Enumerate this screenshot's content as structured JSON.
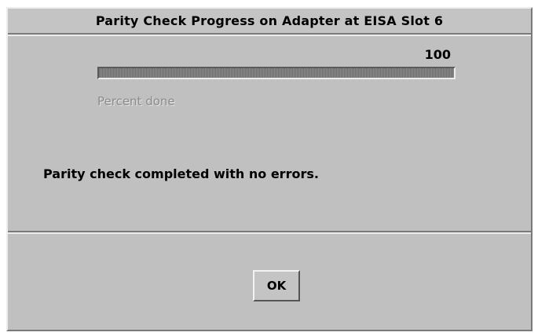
{
  "dialog": {
    "title": "Parity Check Progress on Adapter at EISA Slot 6"
  },
  "progress": {
    "value": "100",
    "percent": 100,
    "caption": "Percent done"
  },
  "status": {
    "message": "Parity check completed with no errors."
  },
  "buttons": {
    "ok_label": "OK"
  }
}
